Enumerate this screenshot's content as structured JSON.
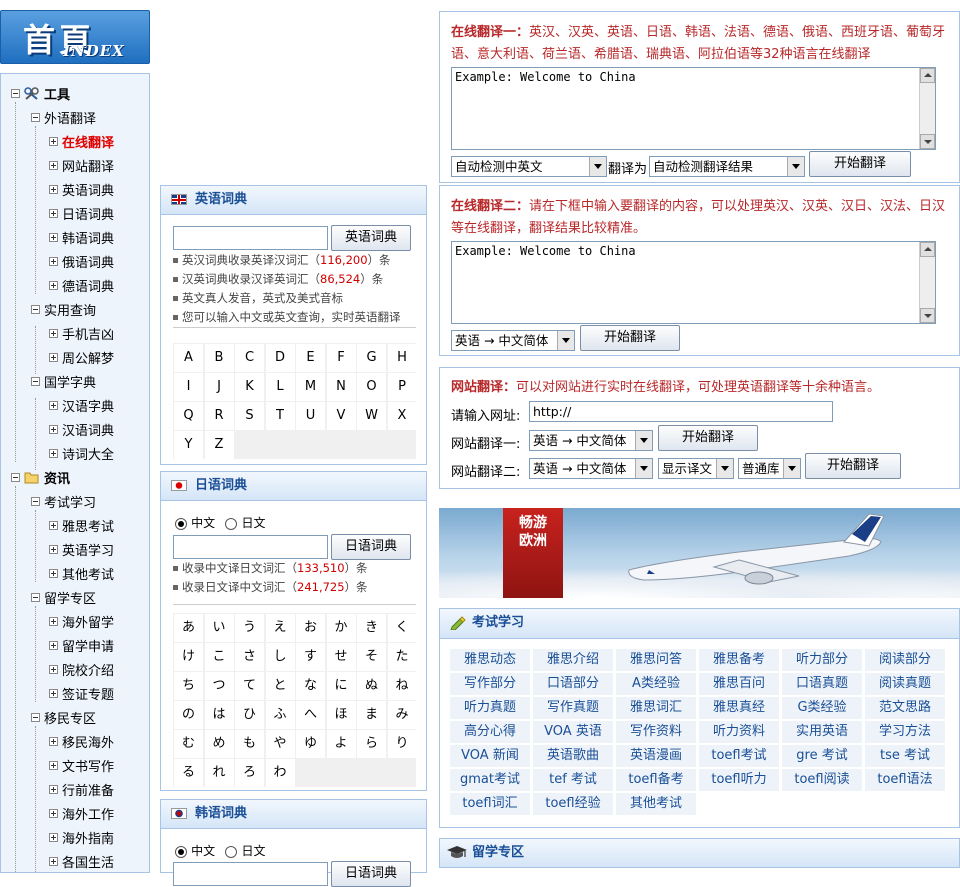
{
  "logo": {
    "main": "首頁",
    "sub": "INDEX"
  },
  "tree": [
    {
      "label": "工具",
      "bold": true,
      "icon": "tools-icon"
    },
    {
      "label": "外语翻译"
    },
    {
      "label": "在线翻译",
      "highlight": true
    },
    {
      "label": "网站翻译"
    },
    {
      "label": "英语词典"
    },
    {
      "label": "日语词典"
    },
    {
      "label": "韩语词典"
    },
    {
      "label": "俄语词典"
    },
    {
      "label": "德语词典"
    },
    {
      "label": "实用查询"
    },
    {
      "label": "手机吉凶"
    },
    {
      "label": "周公解梦"
    },
    {
      "label": "国学字典"
    },
    {
      "label": "汉语字典"
    },
    {
      "label": "汉语词典"
    },
    {
      "label": "诗词大全"
    },
    {
      "label": "资讯",
      "bold": true,
      "icon": "folder-icon"
    },
    {
      "label": "考试学习"
    },
    {
      "label": "雅思考试"
    },
    {
      "label": "英语学习"
    },
    {
      "label": "其他考试"
    },
    {
      "label": "留学专区"
    },
    {
      "label": "海外留学"
    },
    {
      "label": "留学申请"
    },
    {
      "label": "院校介绍"
    },
    {
      "label": "签证专题"
    },
    {
      "label": "移民专区"
    },
    {
      "label": "移民海外"
    },
    {
      "label": "文书写作"
    },
    {
      "label": "行前准备"
    },
    {
      "label": "海外工作"
    },
    {
      "label": "海外指南"
    },
    {
      "label": "各国生活"
    }
  ],
  "english": {
    "title": "英语词典",
    "button": "英语词典",
    "notes": [
      {
        "pre": "英汉词典收录英译汉词汇（",
        "num": "116,200",
        "post": "）条"
      },
      {
        "pre": "汉英词典收录汉译英词汇（",
        "num": "86,524",
        "post": "）条"
      },
      {
        "pre": "英文真人发音，英式及美式音标",
        "num": "",
        "post": ""
      },
      {
        "pre": "您可以输入中文或英文查询，实时英语翻译",
        "num": "",
        "post": ""
      }
    ],
    "letters": [
      "A",
      "B",
      "C",
      "D",
      "E",
      "F",
      "G",
      "H",
      "I",
      "J",
      "K",
      "L",
      "M",
      "N",
      "O",
      "P",
      "Q",
      "R",
      "S",
      "T",
      "U",
      "V",
      "W",
      "X",
      "Y",
      "Z"
    ]
  },
  "japanese": {
    "title": "日语词典",
    "radio1": "中文",
    "radio2": "日文",
    "button": "日语词典",
    "notes": [
      {
        "pre": "收录中文译日文词汇（",
        "num": "133,510",
        "post": "）条"
      },
      {
        "pre": "收录日文译中文词汇（",
        "num": "241,725",
        "post": "）条"
      }
    ],
    "kana": [
      "あ",
      "い",
      "う",
      "え",
      "お",
      "か",
      "き",
      "く",
      "け",
      "こ",
      "さ",
      "し",
      "す",
      "せ",
      "そ",
      "た",
      "ち",
      "つ",
      "て",
      "と",
      "な",
      "に",
      "ぬ",
      "ね",
      "の",
      "は",
      "ひ",
      "ふ",
      "へ",
      "ほ",
      "ま",
      "み",
      "む",
      "め",
      "も",
      "や",
      "ゆ",
      "よ",
      "ら",
      "り",
      "る",
      "れ",
      "ろ",
      "わ"
    ]
  },
  "korean": {
    "title": "韩语词典",
    "radio1": "中文",
    "radio2": "日文",
    "button": "日语词典"
  },
  "translate1": {
    "bold": "在线翻译一：",
    "text": "英汉、汉英、英语、日语、韩语、法语、德语、俄语、西班牙语、葡萄牙语、意大利语、荷兰语、希腊语、瑞典语、阿拉伯语等32种语言在线翻译",
    "textarea": "Example: Welcome to China",
    "select_from": "自动检测中英文",
    "to_label": "翻译为",
    "select_to": "自动检测翻译结果",
    "button": "开始翻译"
  },
  "translate2": {
    "bold": "在线翻译二：",
    "text": "请在下框中输入要翻译的内容，可以处理英汉、汉英、汉日、汉法、日汉等在线翻译，翻译结果比较精准。",
    "textarea": "Example: Welcome to China",
    "select": "英语 → 中文简体",
    "button": "开始翻译"
  },
  "webtrans": {
    "bold": "网站翻译：",
    "text": "可以对网站进行实时在线翻译，可处理英语翻译等十余种语言。",
    "url_label": "请输入网址:",
    "url_value": "http://",
    "row1_label": "网站翻译一:",
    "row1_select": "英语 → 中文简体",
    "row1_button": "开始翻译",
    "row2_label": "网站翻译二:",
    "row2_select": "英语 → 中文简体",
    "row2_select2": "显示译文",
    "row2_select3": "普通库",
    "row2_button": "开始翻译"
  },
  "banner": {
    "text": "畅游欧洲"
  },
  "exam": {
    "title": "考试学习",
    "links": [
      "雅思动态",
      "雅思介绍",
      "雅思问答",
      "雅思备考",
      "听力部分",
      "阅读部分",
      "写作部分",
      "口语部分",
      "A类经验",
      "雅思百问",
      "口语真题",
      "阅读真题",
      "听力真题",
      "写作真题",
      "雅思词汇",
      "雅思真经",
      "G类经验",
      "范文思路",
      "高分心得",
      "VOA 英语",
      "写作资料",
      "听力资料",
      "实用英语",
      "学习方法",
      "VOA 新闻",
      "英语歌曲",
      "英语漫画",
      "toefl考试",
      "gre 考试",
      "tse 考试",
      "gmat考试",
      "tef 考试",
      "toefl备考",
      "toefl听力",
      "toefl阅读",
      "toefl语法",
      "toefl词汇",
      "toefl经验",
      "其他考试"
    ]
  },
  "study": {
    "title": "留学专区"
  },
  "colors": {
    "accent": "#1a4f96",
    "red": "#b8282a",
    "panel_border": "#a8c4e4"
  }
}
